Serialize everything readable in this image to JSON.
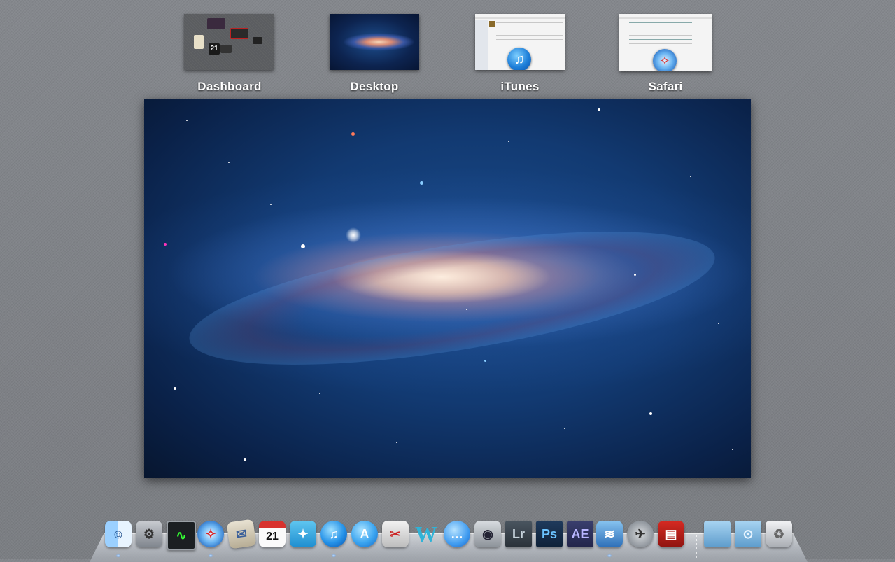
{
  "spaces": {
    "dashboard": {
      "label": "Dashboard",
      "calendar_day": "21"
    },
    "desktop": {
      "label": "Desktop"
    },
    "itunes": {
      "label": "iTunes"
    },
    "safari": {
      "label": "Safari"
    }
  },
  "dock": {
    "items": [
      {
        "name": "finder-icon",
        "glyph": "☺"
      },
      {
        "name": "system-preferences-icon",
        "glyph": "⚙"
      },
      {
        "name": "activity-monitor-icon",
        "glyph": "∿"
      },
      {
        "name": "safari-icon",
        "glyph": "✧"
      },
      {
        "name": "mail-icon",
        "glyph": "✉"
      },
      {
        "name": "ical-icon",
        "glyph": "21"
      },
      {
        "name": "twitter-icon",
        "glyph": "✦"
      },
      {
        "name": "itunes-icon",
        "glyph": "♫"
      },
      {
        "name": "app-store-icon",
        "glyph": "A"
      },
      {
        "name": "tweetie-icon",
        "glyph": "✂"
      },
      {
        "name": "w-app-icon",
        "glyph": "W"
      },
      {
        "name": "ichat-icon",
        "glyph": "…"
      },
      {
        "name": "facetime-icon",
        "glyph": "◉"
      },
      {
        "name": "lightroom-icon",
        "glyph": "Lr"
      },
      {
        "name": "photoshop-icon",
        "glyph": "Ps"
      },
      {
        "name": "after-effects-icon",
        "glyph": "AE"
      },
      {
        "name": "image-capture-icon",
        "glyph": "≋"
      },
      {
        "name": "launchpad-icon",
        "glyph": "✈"
      },
      {
        "name": "photo-booth-icon",
        "glyph": "▤"
      },
      {
        "name": "applications-folder-icon",
        "glyph": ""
      },
      {
        "name": "downloads-folder-icon",
        "glyph": "⊙"
      },
      {
        "name": "trash-icon",
        "glyph": "♻"
      }
    ]
  },
  "colors": {
    "linen": "#7d8085",
    "label": "#ffffff",
    "galaxy_core": "#f6d6b8",
    "galaxy_space": "#0a2148"
  }
}
